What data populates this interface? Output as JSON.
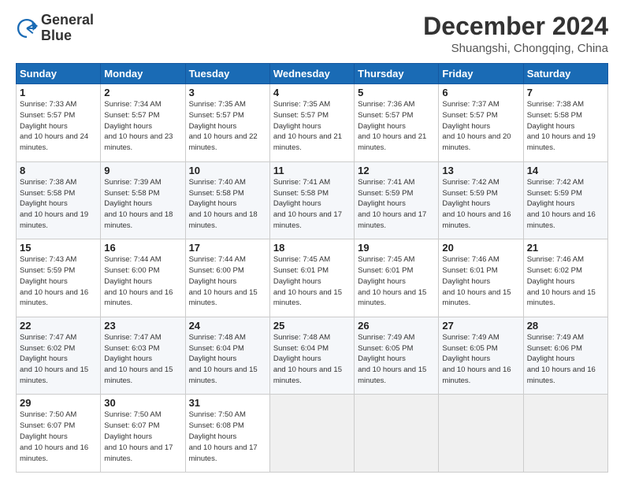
{
  "logo": {
    "line1": "General",
    "line2": "Blue"
  },
  "title": "December 2024",
  "subtitle": "Shuangshi, Chongqing, China",
  "days_header": [
    "Sunday",
    "Monday",
    "Tuesday",
    "Wednesday",
    "Thursday",
    "Friday",
    "Saturday"
  ],
  "weeks": [
    [
      {
        "day": "1",
        "sun": "7:33 AM",
        "set": "5:57 PM",
        "dh": "10 hours and 24 minutes."
      },
      {
        "day": "2",
        "sun": "7:34 AM",
        "set": "5:57 PM",
        "dh": "10 hours and 23 minutes."
      },
      {
        "day": "3",
        "sun": "7:35 AM",
        "set": "5:57 PM",
        "dh": "10 hours and 22 minutes."
      },
      {
        "day": "4",
        "sun": "7:35 AM",
        "set": "5:57 PM",
        "dh": "10 hours and 21 minutes."
      },
      {
        "day": "5",
        "sun": "7:36 AM",
        "set": "5:57 PM",
        "dh": "10 hours and 21 minutes."
      },
      {
        "day": "6",
        "sun": "7:37 AM",
        "set": "5:57 PM",
        "dh": "10 hours and 20 minutes."
      },
      {
        "day": "7",
        "sun": "7:38 AM",
        "set": "5:58 PM",
        "dh": "10 hours and 19 minutes."
      }
    ],
    [
      {
        "day": "8",
        "sun": "7:38 AM",
        "set": "5:58 PM",
        "dh": "10 hours and 19 minutes."
      },
      {
        "day": "9",
        "sun": "7:39 AM",
        "set": "5:58 PM",
        "dh": "10 hours and 18 minutes."
      },
      {
        "day": "10",
        "sun": "7:40 AM",
        "set": "5:58 PM",
        "dh": "10 hours and 18 minutes."
      },
      {
        "day": "11",
        "sun": "7:41 AM",
        "set": "5:58 PM",
        "dh": "10 hours and 17 minutes."
      },
      {
        "day": "12",
        "sun": "7:41 AM",
        "set": "5:59 PM",
        "dh": "10 hours and 17 minutes."
      },
      {
        "day": "13",
        "sun": "7:42 AM",
        "set": "5:59 PM",
        "dh": "10 hours and 16 minutes."
      },
      {
        "day": "14",
        "sun": "7:42 AM",
        "set": "5:59 PM",
        "dh": "10 hours and 16 minutes."
      }
    ],
    [
      {
        "day": "15",
        "sun": "7:43 AM",
        "set": "5:59 PM",
        "dh": "10 hours and 16 minutes."
      },
      {
        "day": "16",
        "sun": "7:44 AM",
        "set": "6:00 PM",
        "dh": "10 hours and 16 minutes."
      },
      {
        "day": "17",
        "sun": "7:44 AM",
        "set": "6:00 PM",
        "dh": "10 hours and 15 minutes."
      },
      {
        "day": "18",
        "sun": "7:45 AM",
        "set": "6:01 PM",
        "dh": "10 hours and 15 minutes."
      },
      {
        "day": "19",
        "sun": "7:45 AM",
        "set": "6:01 PM",
        "dh": "10 hours and 15 minutes."
      },
      {
        "day": "20",
        "sun": "7:46 AM",
        "set": "6:01 PM",
        "dh": "10 hours and 15 minutes."
      },
      {
        "day": "21",
        "sun": "7:46 AM",
        "set": "6:02 PM",
        "dh": "10 hours and 15 minutes."
      }
    ],
    [
      {
        "day": "22",
        "sun": "7:47 AM",
        "set": "6:02 PM",
        "dh": "10 hours and 15 minutes."
      },
      {
        "day": "23",
        "sun": "7:47 AM",
        "set": "6:03 PM",
        "dh": "10 hours and 15 minutes."
      },
      {
        "day": "24",
        "sun": "7:48 AM",
        "set": "6:04 PM",
        "dh": "10 hours and 15 minutes."
      },
      {
        "day": "25",
        "sun": "7:48 AM",
        "set": "6:04 PM",
        "dh": "10 hours and 15 minutes."
      },
      {
        "day": "26",
        "sun": "7:49 AM",
        "set": "6:05 PM",
        "dh": "10 hours and 15 minutes."
      },
      {
        "day": "27",
        "sun": "7:49 AM",
        "set": "6:05 PM",
        "dh": "10 hours and 16 minutes."
      },
      {
        "day": "28",
        "sun": "7:49 AM",
        "set": "6:06 PM",
        "dh": "10 hours and 16 minutes."
      }
    ],
    [
      {
        "day": "29",
        "sun": "7:50 AM",
        "set": "6:07 PM",
        "dh": "10 hours and 16 minutes."
      },
      {
        "day": "30",
        "sun": "7:50 AM",
        "set": "6:07 PM",
        "dh": "10 hours and 17 minutes."
      },
      {
        "day": "31",
        "sun": "7:50 AM",
        "set": "6:08 PM",
        "dh": "10 hours and 17 minutes."
      },
      null,
      null,
      null,
      null
    ]
  ]
}
